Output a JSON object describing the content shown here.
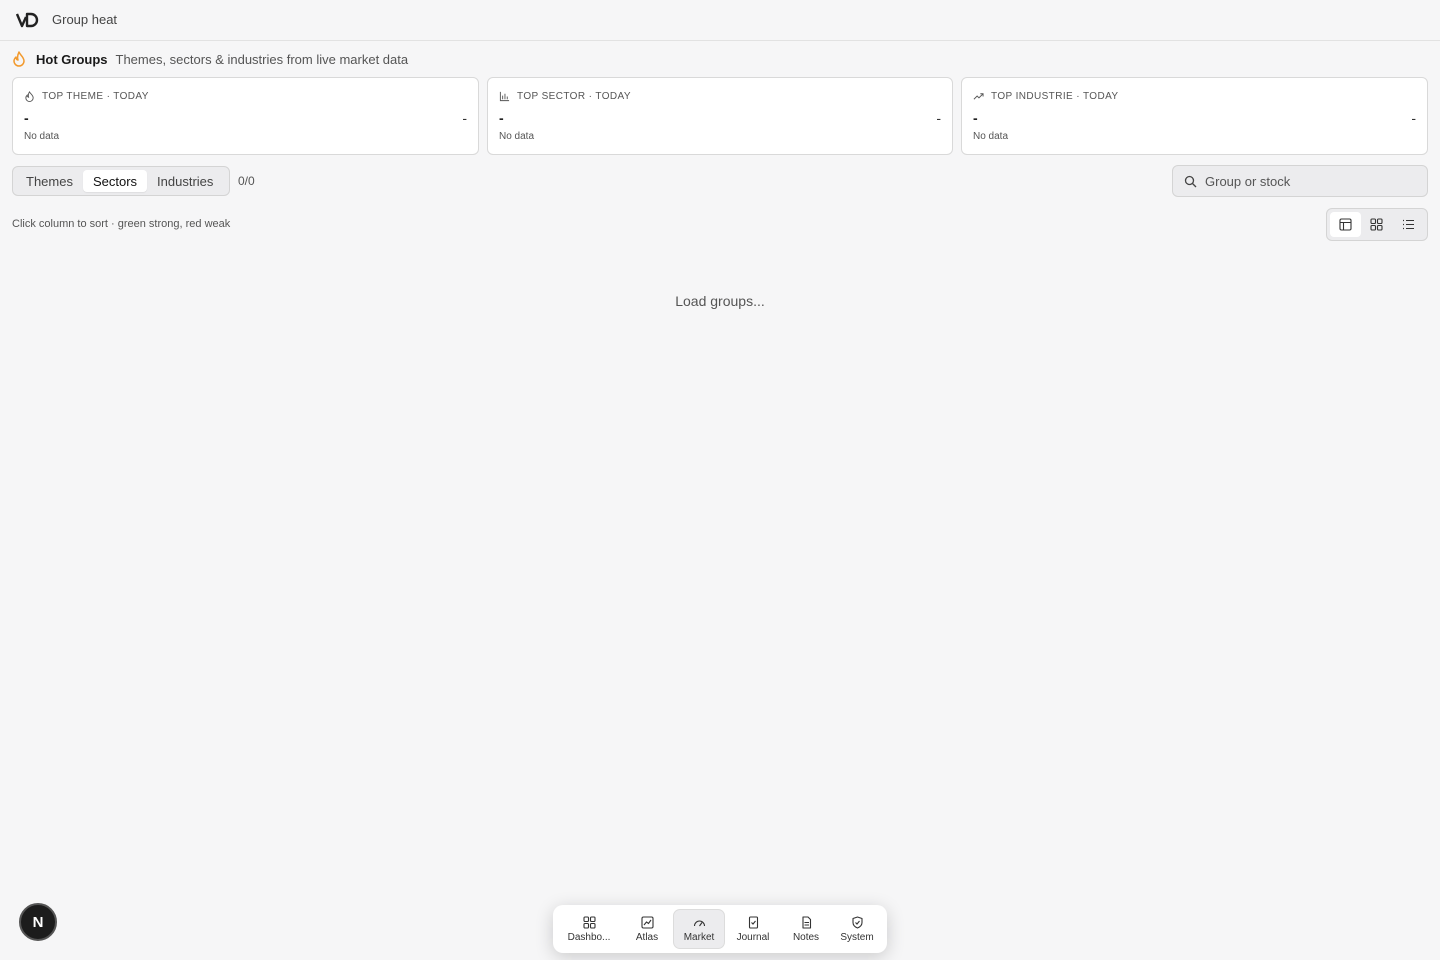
{
  "header": {
    "title": "Group heat",
    "logo": "brand-logo"
  },
  "section": {
    "title": "Hot Groups",
    "subtitle": "Themes, sectors & industries from live market data",
    "icon": "flame-icon"
  },
  "cards": [
    {
      "label": "TOP THEME · TODAY",
      "icon": "flame-icon",
      "name": "-",
      "value": "-",
      "sub": "No data"
    },
    {
      "label": "TOP SECTOR · TODAY",
      "icon": "bar-chart-icon",
      "name": "-",
      "value": "-",
      "sub": "No data"
    },
    {
      "label": "TOP INDUSTRIE · TODAY",
      "icon": "trending-up-icon",
      "name": "-",
      "value": "-",
      "sub": "No data"
    }
  ],
  "tabs": [
    {
      "label": "Themes",
      "active": false
    },
    {
      "label": "Sectors",
      "active": true
    },
    {
      "label": "Industries",
      "active": false
    }
  ],
  "count": "0/0",
  "search": {
    "placeholder": "Group or stock",
    "value": ""
  },
  "hint": "Click column to sort · green strong, red weak",
  "view_toggle": [
    "table-view-icon",
    "grid-view-icon",
    "list-view-icon"
  ],
  "loading": "Load groups...",
  "badge": "N",
  "dock": [
    {
      "label": "Dashbo...",
      "icon": "dashboard-icon",
      "active": false
    },
    {
      "label": "Atlas",
      "icon": "chart-icon",
      "active": false
    },
    {
      "label": "Market",
      "icon": "gauge-icon",
      "active": true
    },
    {
      "label": "Journal",
      "icon": "journal-icon",
      "active": false
    },
    {
      "label": "Notes",
      "icon": "notes-icon",
      "active": false
    },
    {
      "label": "System",
      "icon": "shield-icon",
      "active": false
    }
  ],
  "colors": {
    "accent": "#f29a2e",
    "background": "#f6f6f7",
    "card": "#ffffff"
  }
}
